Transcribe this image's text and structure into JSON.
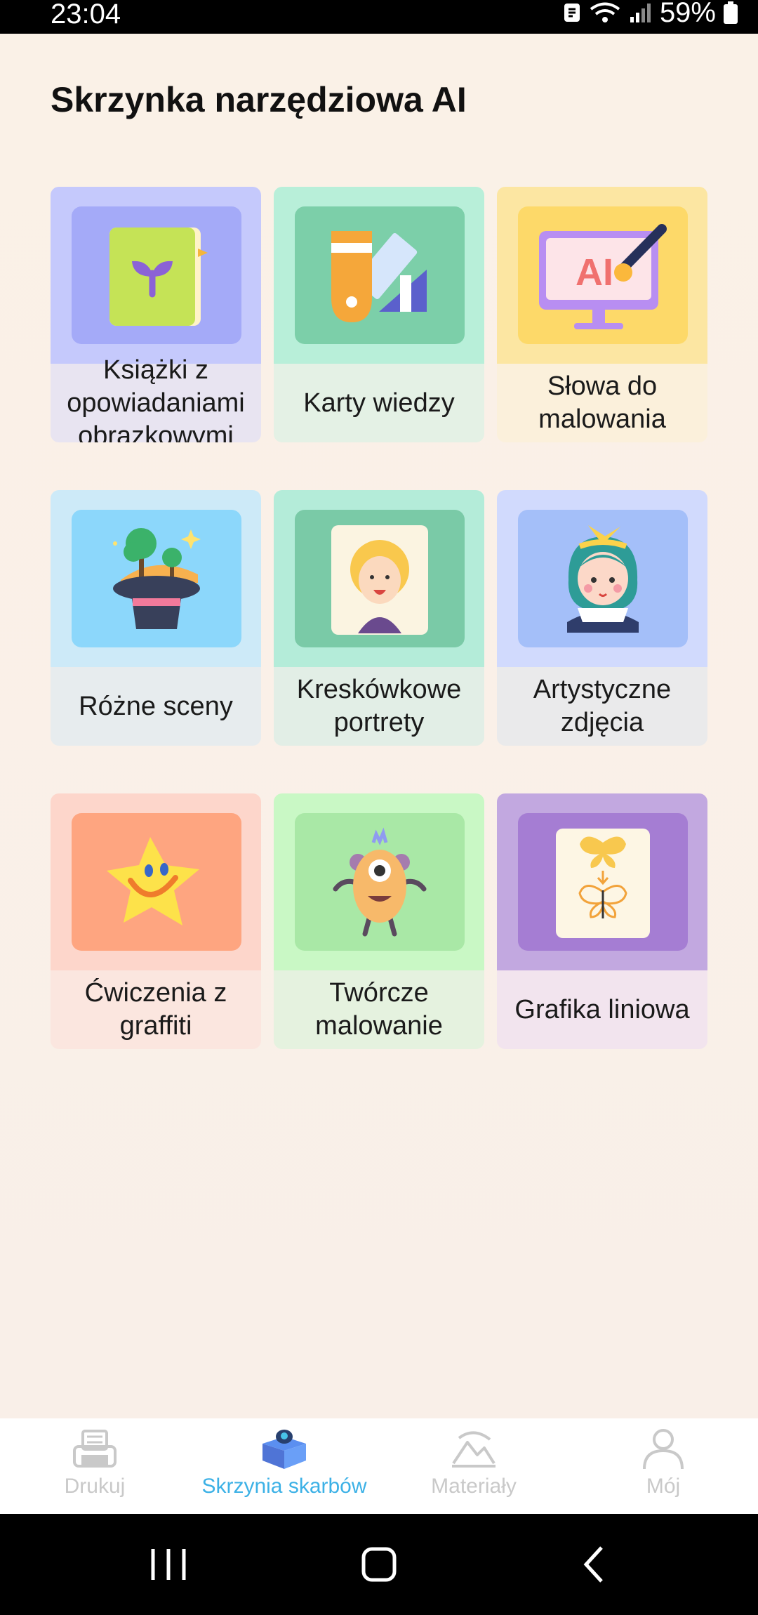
{
  "status_bar": {
    "time": "23:04",
    "battery": "59%"
  },
  "page": {
    "title": "Skrzynka narzędziowa AI"
  },
  "tools": [
    {
      "label": "Książki z opowiadaniami obrazkowymi",
      "icon": "picture-book-icon",
      "top_color": "#c5c9fc",
      "image_color": "#a4aaf8",
      "bottom_color": "#e8e4f1"
    },
    {
      "label": "Karty wiedzy",
      "icon": "color-swatch-icon",
      "top_color": "#b8efd9",
      "image_color": "#7ccfa9",
      "bottom_color": "#e4f1e5"
    },
    {
      "label": "Słowa do malowania",
      "icon": "ai-monitor-icon",
      "top_color": "#fce6a2",
      "image_color": "#fdd969",
      "bottom_color": "#fbf0db"
    },
    {
      "label": "Różne sceny",
      "icon": "magic-hat-icon",
      "top_color": "#cdeaf8",
      "image_color": "#8cd7fb",
      "bottom_color": "#e7ecee"
    },
    {
      "label": "Kreskówkowe portrety",
      "icon": "cartoon-portrait-icon",
      "top_color": "#b4ecd9",
      "image_color": "#7acaa7",
      "bottom_color": "#e2eee6"
    },
    {
      "label": "Artystyczne zdjęcia",
      "icon": "artistic-girl-icon",
      "top_color": "#d1dafd",
      "image_color": "#a4bff9",
      "bottom_color": "#eaeaeb"
    },
    {
      "label": "Ćwiczenia z graffiti",
      "icon": "graffiti-star-icon",
      "top_color": "#fdd6cb",
      "image_color": "#fea580",
      "bottom_color": "#fbe6df"
    },
    {
      "label": "Twórcze malowanie",
      "icon": "monster-icon",
      "top_color": "#c9f8c5",
      "image_color": "#a9e8a6",
      "bottom_color": "#e5f2df"
    },
    {
      "label": "Grafika liniowa",
      "icon": "butterfly-line-icon",
      "top_color": "#c2a8e0",
      "image_color": "#a57dd3",
      "bottom_color": "#f2e4ee"
    }
  ],
  "nav": {
    "items": [
      {
        "label": "Drukuj",
        "icon": "printer-icon",
        "active": false
      },
      {
        "label": "Skrzynia skarbów",
        "icon": "treasure-box-icon",
        "active": true
      },
      {
        "label": "Materiały",
        "icon": "image-landscape-icon",
        "active": false
      },
      {
        "label": "Mój",
        "icon": "user-profile-icon",
        "active": false
      }
    ],
    "active_color": "#3cb1e6",
    "inactive_color": "#c9c9c9"
  }
}
